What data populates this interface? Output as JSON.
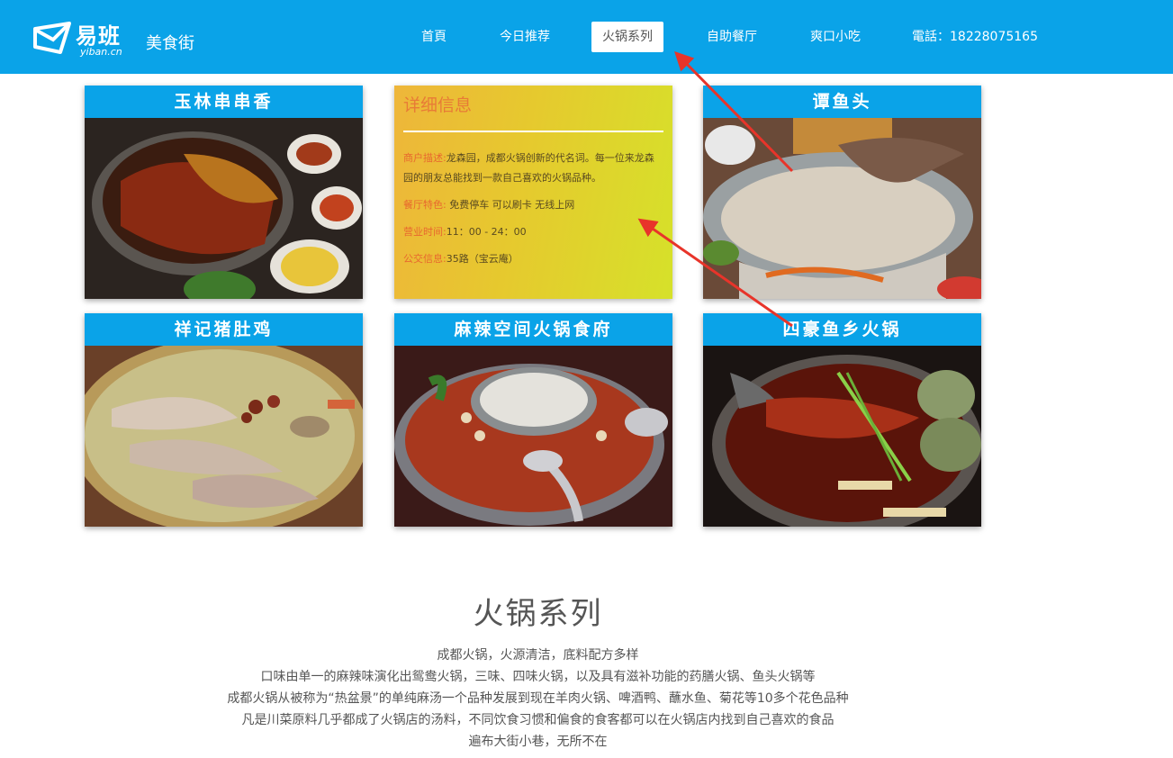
{
  "header": {
    "logo_cn": "易班",
    "logo_en": "yiban.cn",
    "site_name": "美食街",
    "nav": [
      {
        "label": "首頁"
      },
      {
        "label": "今日推荐"
      },
      {
        "label": "火锅系列",
        "active": true
      },
      {
        "label": "自助餐厅"
      },
      {
        "label": "爽口小吃"
      },
      {
        "label": "電話：18228075165"
      }
    ]
  },
  "cards": [
    {
      "title": "玉林串串香",
      "image": "hotpot-yuanyang-photo"
    },
    {
      "title": "谭鱼头",
      "image": "fish-head-hotpot-photo"
    },
    {
      "title": "祥记猪肚鸡",
      "image": "pork-tripe-chicken-photo"
    },
    {
      "title": "麻辣空间火锅食府",
      "image": "mala-hotpot-photo"
    },
    {
      "title": "四豪鱼乡火锅",
      "image": "fish-hotpot-photo"
    }
  ],
  "detail": {
    "title": "详细信息",
    "rows": [
      {
        "key": "商户描述:",
        "value": "龙森园，成都火锅创新的代名词。每一位来龙森园的朋友总能找到一款自己喜欢的火锅品种。"
      },
      {
        "key": "餐厅特色:",
        "value": " 免费停车 可以刷卡 无线上网"
      },
      {
        "key": "营业时间:",
        "value": "11：00 - 24：00"
      },
      {
        "key": "公交信息:",
        "value": "35路（宝云庵）"
      }
    ]
  },
  "section": {
    "title": "火锅系列",
    "lines": [
      "成都火锅，火源清洁，底料配方多样",
      "口味由单一的麻辣味演化出鸳鸯火锅，三味、四味火锅，以及具有滋补功能的药膳火锅、鱼头火锅等",
      "成都火锅从被称为“热盆景”的单纯麻汤一个品种发展到现在羊肉火锅、啤酒鸭、蘸水鱼、菊花等10多个花色品种",
      "凡是川菜原料几乎都成了火锅店的汤料，不同饮食习惯和偏食的食客都可以在火锅店内找到自己喜欢的食品",
      "遍布大街小巷，无所不在"
    ]
  },
  "colors": {
    "brand": "#0aa3e8",
    "detail_key": "#e8672e",
    "arrow": "#e8342a"
  }
}
